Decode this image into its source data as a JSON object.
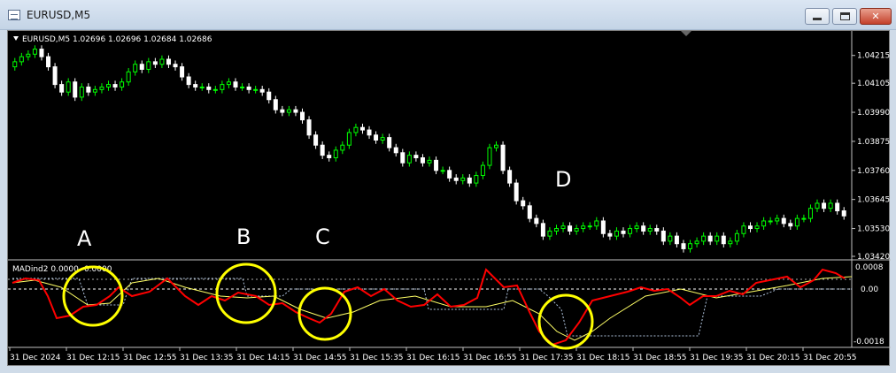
{
  "window": {
    "title": "EURUSD,M5",
    "icon": "chart-window-icon",
    "buttons": {
      "minimize": "minimize-icon",
      "maximize": "maximize-icon",
      "close": "close-icon"
    }
  },
  "main_chart": {
    "header": "EURUSD,M5  1.02696 1.02696 1.02684 1.02686",
    "price_ticks": [
      "1.04215",
      "1.04105",
      "1.03990",
      "1.03875",
      "1.03760",
      "1.03645",
      "1.03530",
      "1.03420"
    ],
    "annotations": [
      "A",
      "B",
      "C",
      "D"
    ]
  },
  "indicator": {
    "header": "MADind2 0.0000 -0.0000",
    "ticks": [
      "0.0008",
      "0.00",
      "-0.0018"
    ]
  },
  "time_labels": [
    "31 Dec 2024",
    "31 Dec 12:15",
    "31 Dec 12:55",
    "31 Dec 13:35",
    "31 Dec 14:15",
    "31 Dec 14:55",
    "31 Dec 15:35",
    "31 Dec 16:15",
    "31 Dec 16:55",
    "31 Dec 17:35",
    "31 Dec 18:15",
    "31 Dec 18:55",
    "31 Dec 19:35",
    "31 Dec 20:15",
    "31 Dec 20:55"
  ],
  "colors": {
    "background": "#000000",
    "bull": "#00ff00",
    "bear": "#ffffff",
    "indicator_main": "#ff0000",
    "indicator_signal": "#ffff66",
    "indicator_band": "#b0c4de",
    "circle": "#ffff00",
    "text": "#ffffff"
  },
  "chart_data": {
    "type": "candlestick",
    "y_range": [
      1.0342,
      1.0427
    ],
    "closes": [
      1.0419,
      1.0421,
      1.0422,
      1.0424,
      1.0421,
      1.0417,
      1.041,
      1.0407,
      1.0411,
      1.0405,
      1.0409,
      1.0407,
      1.0408,
      1.0409,
      1.041,
      1.0409,
      1.0411,
      1.0415,
      1.0418,
      1.0416,
      1.0419,
      1.0418,
      1.042,
      1.0418,
      1.0417,
      1.0413,
      1.041,
      1.0409,
      1.0409,
      1.0408,
      1.0408,
      1.041,
      1.0411,
      1.0409,
      1.0409,
      1.0408,
      1.0408,
      1.0407,
      1.0404,
      1.04,
      1.0399,
      1.04,
      1.0399,
      1.0396,
      1.039,
      1.0386,
      1.0382,
      1.0381,
      1.0384,
      1.0386,
      1.0391,
      1.0393,
      1.0392,
      1.039,
      1.0388,
      1.0389,
      1.0385,
      1.0383,
      1.0379,
      1.0382,
      1.0381,
      1.0379,
      1.038,
      1.0376,
      1.0376,
      1.0373,
      1.0372,
      1.0373,
      1.0371,
      1.0374,
      1.0378,
      1.0385,
      1.0386,
      1.0376,
      1.0371,
      1.0364,
      1.0362,
      1.0357,
      1.0355,
      1.035,
      1.0352,
      1.0353,
      1.0354,
      1.0352,
      1.0353,
      1.0354,
      1.0354,
      1.0356,
      1.0351,
      1.035,
      1.0352,
      1.0351,
      1.0353,
      1.0354,
      1.0352,
      1.0353,
      1.0352,
      1.0348,
      1.035,
      1.0347,
      1.0345,
      1.0347,
      1.0348,
      1.035,
      1.0348,
      1.035,
      1.0347,
      1.0348,
      1.0351,
      1.0354,
      1.0353,
      1.0354,
      1.0356,
      1.0356,
      1.0357,
      1.0355,
      1.0354,
      1.0357,
      1.0357,
      1.0361,
      1.0363,
      1.0361,
      1.0363,
      1.036,
      1.0358
    ]
  }
}
